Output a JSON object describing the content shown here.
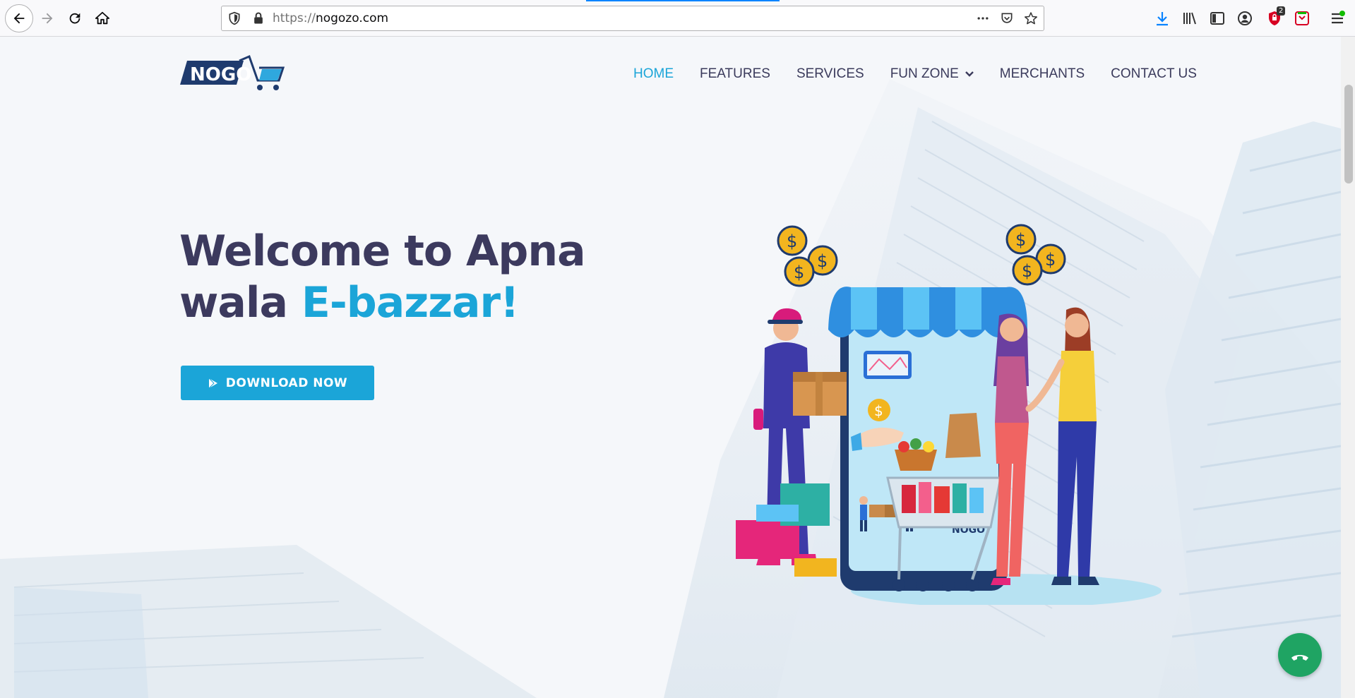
{
  "browser": {
    "url_protocol": "https://",
    "url_domain": "nogozo.com",
    "toolbar_badges": {
      "shield_count": "2"
    }
  },
  "site": {
    "logo_text": "NOGO",
    "nav": [
      {
        "label": "HOME",
        "active": true
      },
      {
        "label": "FEATURES",
        "active": false
      },
      {
        "label": "SERVICES",
        "active": false
      },
      {
        "label": "FUN ZONE",
        "active": false,
        "has_dropdown": true
      },
      {
        "label": "MERCHANTS",
        "active": false
      },
      {
        "label": "CONTACT US",
        "active": false
      }
    ],
    "hero": {
      "title_line1": "Welcome to Apna",
      "title_line2_plain": "wala ",
      "title_line2_accent": "E-bazzar!",
      "cta_label": "DOWNLOAD NOW"
    }
  },
  "colors": {
    "accent": "#1ba5d8",
    "heading": "#3c3a5e",
    "nav_text": "#3b3b5c",
    "call_button": "#1fa463"
  },
  "icons": {
    "back": "arrow-left-icon",
    "forward": "arrow-right-icon",
    "reload": "reload-icon",
    "home": "home-icon",
    "cta": "play-store-icon",
    "fab": "phone-icon"
  }
}
